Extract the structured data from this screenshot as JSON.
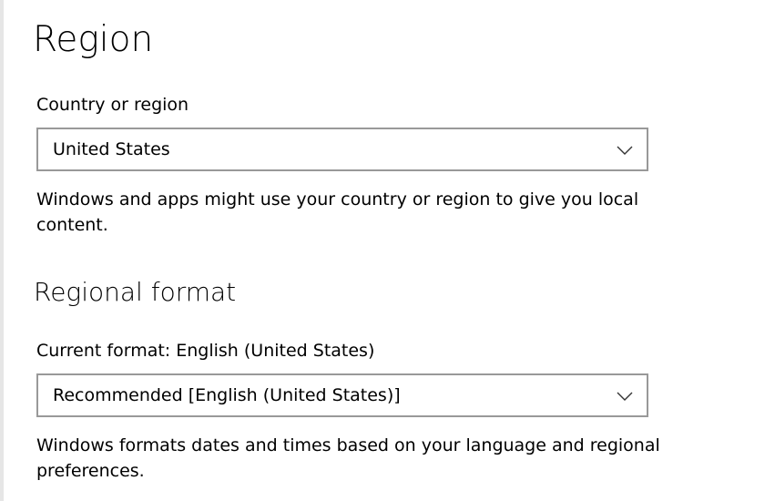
{
  "region": {
    "title": "Region",
    "country_label": "Country or region",
    "country_value": "United States",
    "country_description": "Windows and apps might use your country or region to give you local content."
  },
  "regional_format": {
    "title": "Regional format",
    "current_format_label": "Current format: English (United States)",
    "format_value": "Recommended [English (United States)]",
    "format_description": "Windows formats dates and times based on your language and regional preferences."
  },
  "icons": {
    "dropdown": "chevron-down-icon"
  },
  "colors": {
    "combo_border": "#999999",
    "text": "#000000",
    "background": "#ffffff"
  }
}
